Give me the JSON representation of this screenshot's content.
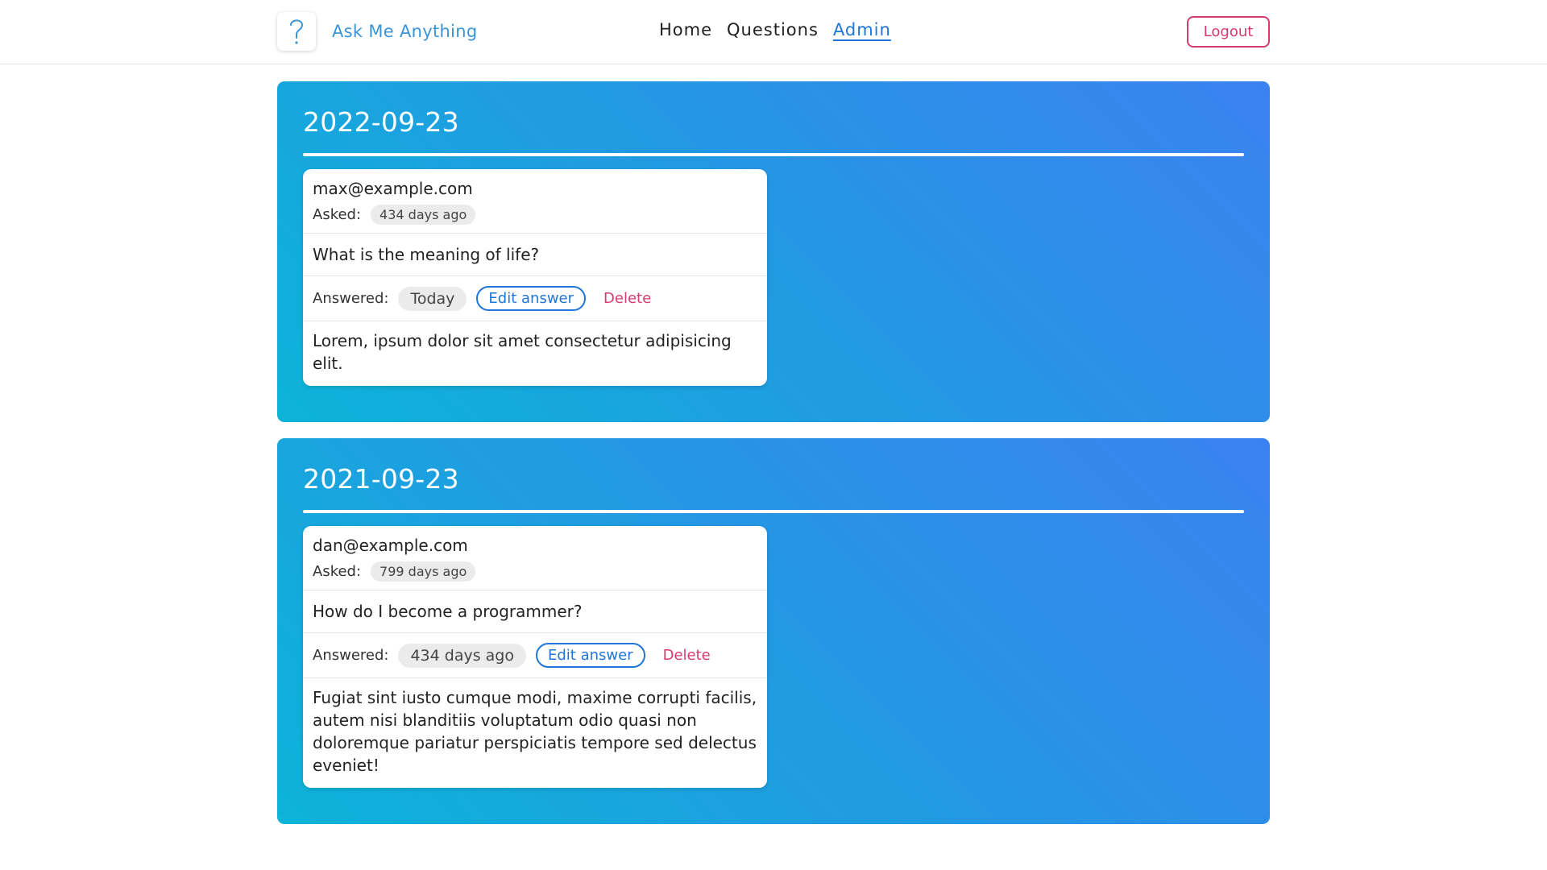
{
  "header": {
    "brand_title": "Ask Me Anything",
    "logo_icon": "question-mark-icon",
    "nav": [
      {
        "label": "Home"
      },
      {
        "label": "Questions"
      },
      {
        "label": "Admin"
      }
    ],
    "active_nav": "Admin",
    "logout_label": "Logout"
  },
  "colors": {
    "brand": "#3a95d6",
    "accent_blue": "#2076d6",
    "danger": "#d63a72",
    "panel_gradient_start": "#0cb4d8",
    "panel_gradient_end": "#3b82f0"
  },
  "days": [
    {
      "date": "2022-09-23",
      "questions": [
        {
          "email": "max@example.com",
          "asked_label": "Asked:",
          "asked_ago": "434 days ago",
          "question": "What is the meaning of life?",
          "answered_label": "Answered:",
          "answered_ago": "Today",
          "edit_label": "Edit answer",
          "delete_label": "Delete",
          "answer": "Lorem, ipsum dolor sit amet consectetur adipisicing elit."
        }
      ]
    },
    {
      "date": "2021-09-23",
      "questions": [
        {
          "email": "dan@example.com",
          "asked_label": "Asked:",
          "asked_ago": "799 days ago",
          "question": "How do I become a programmer?",
          "answered_label": "Answered:",
          "answered_ago": "434 days ago",
          "edit_label": "Edit answer",
          "delete_label": "Delete",
          "answer": "Fugiat sint iusto cumque modi, maxime corrupti facilis, autem nisi blanditiis voluptatum odio quasi non doloremque pariatur perspiciatis tempore sed delectus eveniet!"
        }
      ]
    }
  ]
}
